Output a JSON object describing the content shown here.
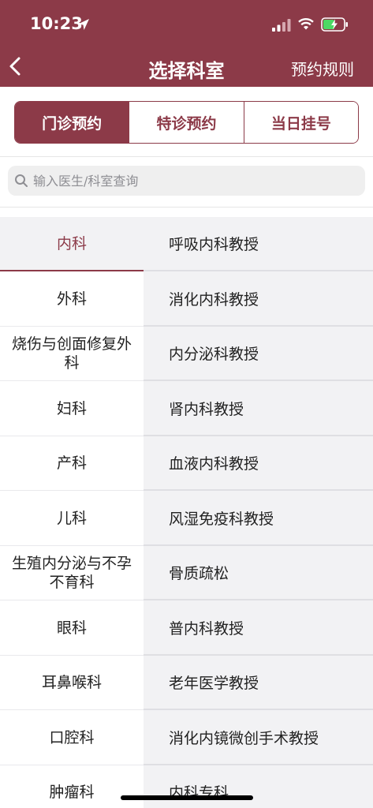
{
  "status_bar": {
    "time": "10:23"
  },
  "nav": {
    "title": "选择科室",
    "rules_label": "预约规则"
  },
  "tabs": [
    {
      "label": "门诊预约",
      "active": true
    },
    {
      "label": "特诊预约",
      "active": false
    },
    {
      "label": "当日挂号",
      "active": false
    }
  ],
  "search": {
    "placeholder": "输入医生/科室查询"
  },
  "departments": [
    {
      "label": "内科"
    },
    {
      "label": "外科"
    },
    {
      "label": "烧伤与创面修复外科"
    },
    {
      "label": "妇科"
    },
    {
      "label": "产科"
    },
    {
      "label": "儿科"
    },
    {
      "label": "生殖内分泌与不孕不育科"
    },
    {
      "label": "眼科"
    },
    {
      "label": "耳鼻喉科"
    },
    {
      "label": "口腔科"
    },
    {
      "label": "肿瘤科"
    }
  ],
  "selected_department": "内科",
  "clinics": [
    {
      "label": "呼吸内科教授"
    },
    {
      "label": "消化内科教授"
    },
    {
      "label": "内分泌科教授"
    },
    {
      "label": "肾内科教授"
    },
    {
      "label": "血液内科教授"
    },
    {
      "label": "风湿免疫科教授"
    },
    {
      "label": "骨质疏松"
    },
    {
      "label": "普内科教授"
    },
    {
      "label": "老年医学教授"
    },
    {
      "label": "消化内镜微创手术教授"
    },
    {
      "label": "内科专科"
    }
  ],
  "colors": {
    "brand": "#8c3a48",
    "list_bg": "#f2f2f4",
    "battery_fill": "#4cd964"
  },
  "icons": [
    "location-arrow-icon",
    "signal-icon",
    "wifi-icon",
    "battery-charging-icon",
    "back-chevron-icon",
    "search-icon"
  ]
}
